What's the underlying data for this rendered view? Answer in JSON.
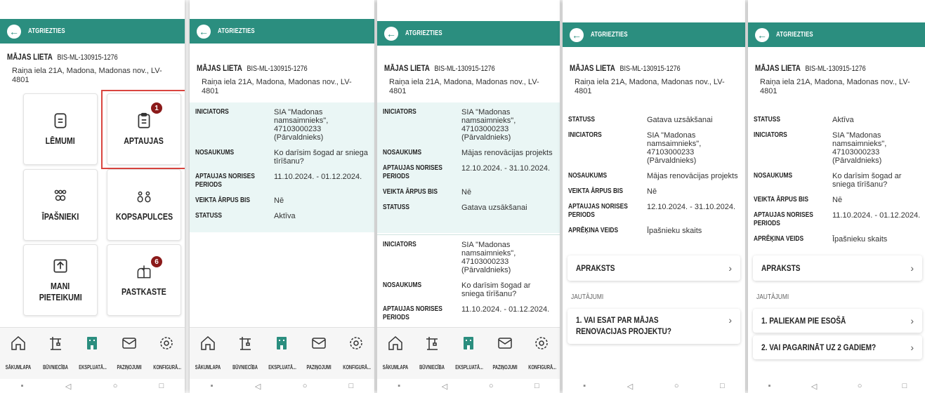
{
  "back_label": "ATGRIEZTIES",
  "house": {
    "title": "MĀJAS LIETA",
    "code": "BIS-ML-130915-1276",
    "address": "Raiņa iela 21A, Madona, Madonas nov., LV-4801"
  },
  "tiles": {
    "lemumi": "LĒMUMI",
    "aptaujas": "APTAUJAS",
    "aptaujas_badge": "1",
    "ipasnieki": "ĪPAŠNIEKI",
    "kopsapulces": "KOPSAPULCES",
    "mani_line1": "MANI",
    "mani_line2": "PIETEIKUMI",
    "pastkaste": "PASTKASTE",
    "pastkaste_badge": "6"
  },
  "labels": {
    "iniciators": "INICIATORS",
    "nosaukums": "NOSAUKUMS",
    "periods": "APTAUJAS NORISES PERIODS",
    "arpus": "VEIKTA ĀRPUS BIS",
    "statuss": "STATUSS",
    "aprekina": "APRĒĶINA VEIDS"
  },
  "values": {
    "iniciators": "SIA \"Madonas namsaimnieks\", 47103000233 (Pārvaldnieks)",
    "sniegs": "Ko darīsim šogad ar sniega tīrīšanu?",
    "renovacija": "Mājas renovācijas projekts",
    "period1": "11.10.2024. - 01.12.2024.",
    "period2": "12.10.2024. - 31.10.2024.",
    "ne": "Nē",
    "aktiva": "Aktīva",
    "gatava": "Gatava uzsākšanai",
    "ipasnieku_skaits": "Īpašnieku skaits"
  },
  "detail": {
    "apraksts": "APRAKSTS",
    "jautajumi": "JAUTĀJUMI",
    "q_renovacija": "1. VAI ESAT PAR MĀJAS RENOVACIJAS PROJEKTU?",
    "q1": "1. PALIEKAM PIE ESOŠĀ",
    "q2": "2. VAI PAGARINĀT UZ 2 GADIEM?"
  },
  "nav": {
    "sakumlapa": "SĀKUMLAPA",
    "buvnieciba": "BŪVNIECĪBA",
    "ekspluata": "EKSPLUATĀ...",
    "pazinojumi": "PAZIŅOJUMI",
    "konfigura": "KONFIGURĀ..."
  },
  "colors": {
    "accent": "#2b8e7f",
    "badge": "#8b1a1a",
    "highlight": "#d9453f",
    "panel": "#eaf6f5"
  }
}
